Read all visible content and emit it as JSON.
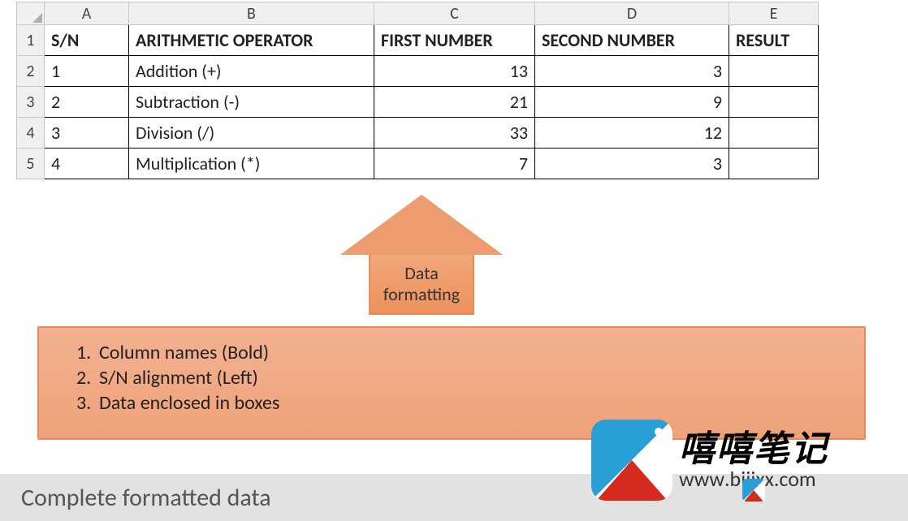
{
  "columns": {
    "a": "A",
    "b": "B",
    "c": "C",
    "d": "D",
    "e": "E"
  },
  "rowLabels": [
    "1",
    "2",
    "3",
    "4",
    "5"
  ],
  "table": {
    "headers": {
      "sn": "S/N",
      "op": "ARITHMETIC OPERATOR",
      "first": "FIRST NUMBER",
      "second": "SECOND NUMBER",
      "result": "RESULT"
    },
    "rows": [
      {
        "sn": "1",
        "op": "Addition (+)",
        "first": "13",
        "second": "3",
        "result": ""
      },
      {
        "sn": "2",
        "op": "Subtraction (-)",
        "first": "21",
        "second": "9",
        "result": ""
      },
      {
        "sn": "3",
        "op": "Division (/)",
        "first": "33",
        "second": "12",
        "result": ""
      },
      {
        "sn": "4",
        "op": "Multiplication (*)",
        "first": "7",
        "second": "3",
        "result": ""
      }
    ]
  },
  "arrow": {
    "label": "Data formatting"
  },
  "notes": {
    "items": [
      "Column names (Bold)",
      "S/N alignment (Left)",
      "Data enclosed in boxes"
    ]
  },
  "footer": {
    "text": "Complete formatted data"
  },
  "watermark": {
    "cn": "嘻嘻笔记",
    "url_prefix": "www",
    "url": ".bijixx.com"
  }
}
